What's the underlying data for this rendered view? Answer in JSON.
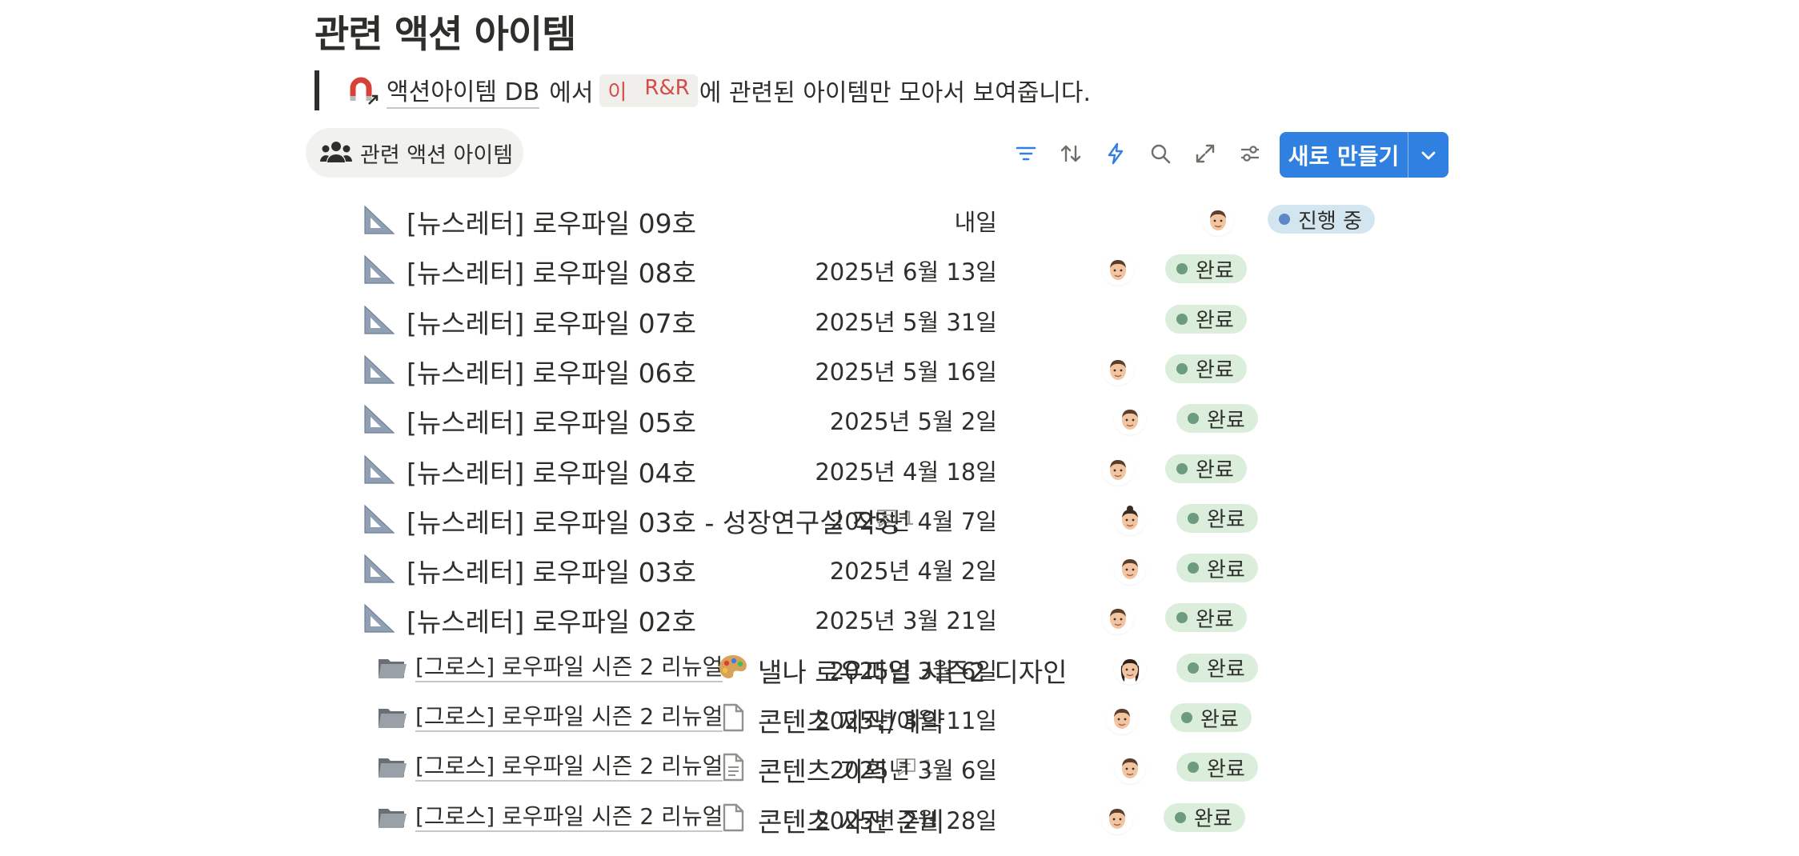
{
  "page": {
    "title": "관련 액션 아이템"
  },
  "callout": {
    "db_link": "액션아이템 DB",
    "text_before": "에서",
    "pill_this": "이",
    "pill_rr": "R&R",
    "text_after": "에 관련된 아이템만 모아서 보여줍니다."
  },
  "view_tab": {
    "label": "관련 액션 아이템"
  },
  "toolbar": {
    "icons": [
      "filter-icon",
      "sort-icon",
      "lightning-icon",
      "search-icon",
      "expand-icon",
      "settings-sliders-icon"
    ],
    "new_button": "새로 만들기"
  },
  "colors": {
    "accent": "#2f80e0",
    "status_done_bg": "#dbeddb",
    "status_done_dot": "#6c9b7d",
    "status_progress_bg": "#d3e5ef",
    "status_progress_dot": "#5e87c9"
  },
  "rows": [
    {
      "icon": "triangle-ruler-icon",
      "name": "[뉴스레터] 로우파일 09호",
      "status": "진행 중",
      "date": "내일",
      "avatar": "memoji-man-icon"
    },
    {
      "icon": "triangle-ruler-icon",
      "name": "[뉴스레터] 로우파일 08호",
      "status": "완료",
      "date": "2025년 6월 13일",
      "avatar": "memoji-man-icon"
    },
    {
      "icon": "triangle-ruler-icon",
      "name": "[뉴스레터] 로우파일 07호",
      "status": "완료",
      "date": "2025년 5월 31일",
      "avatar": ""
    },
    {
      "icon": "triangle-ruler-icon",
      "name": "[뉴스레터] 로우파일 06호",
      "status": "완료",
      "date": "2025년 5월 16일",
      "avatar": "memoji-man-icon"
    },
    {
      "icon": "triangle-ruler-icon",
      "name": "[뉴스레터] 로우파일 05호",
      "status": "완료",
      "date": "2025년 5월 2일",
      "avatar": "memoji-man-icon"
    },
    {
      "icon": "triangle-ruler-icon",
      "name": "[뉴스레터] 로우파일 04호",
      "status": "완료",
      "date": "2025년 4월 18일",
      "avatar": "memoji-man-icon"
    },
    {
      "icon": "triangle-ruler-icon",
      "name": "[뉴스레터] 로우파일 03호 - 성장연구실 작성",
      "comments": "1",
      "status": "완료",
      "date": "2025년 4월 7일",
      "avatar": "memoji-woman-bun-icon"
    },
    {
      "icon": "triangle-ruler-icon",
      "name": "[뉴스레터] 로우파일 03호",
      "status": "완료",
      "date": "2025년 4월 2일",
      "avatar": "memoji-man-icon"
    },
    {
      "icon": "triangle-ruler-icon",
      "name": "[뉴스레터] 로우파일 02호",
      "status": "완료",
      "date": "2025년 3월 21일",
      "avatar": "memoji-man-icon"
    },
    {
      "icon": "folder-icon",
      "parent": "[그로스] 로우파일 시즌 2 리뉴얼",
      "sub_icon": "palette-icon",
      "name": "낼나 로우파일 시즌2 디자인",
      "status": "완료",
      "date": "2025년 3월 6일",
      "avatar": "memoji-woman-icon"
    },
    {
      "icon": "folder-icon",
      "parent": "[그로스] 로우파일 시즌 2 리뉴얼",
      "sub_icon": "page-icon",
      "name": "콘텐츠 제작/예약",
      "status": "완료",
      "date": "2025년 3월 11일",
      "avatar": "memoji-man-icon"
    },
    {
      "icon": "folder-icon",
      "parent": "[그로스] 로우파일 시즌 2 리뉴얼",
      "sub_icon": "page-lines-icon",
      "name": "콘텐츠 기획",
      "comments": "1",
      "status": "완료",
      "date": "2025년 3월 6일",
      "avatar": "memoji-man-icon"
    },
    {
      "icon": "folder-icon",
      "parent": "[그로스] 로우파일 시즌 2 리뉴얼",
      "sub_icon": "page-icon",
      "name": "콘텐츠 사전 준비",
      "status": "완료",
      "date": "2025년 2월 28일",
      "avatar": "memoji-man-icon"
    }
  ]
}
